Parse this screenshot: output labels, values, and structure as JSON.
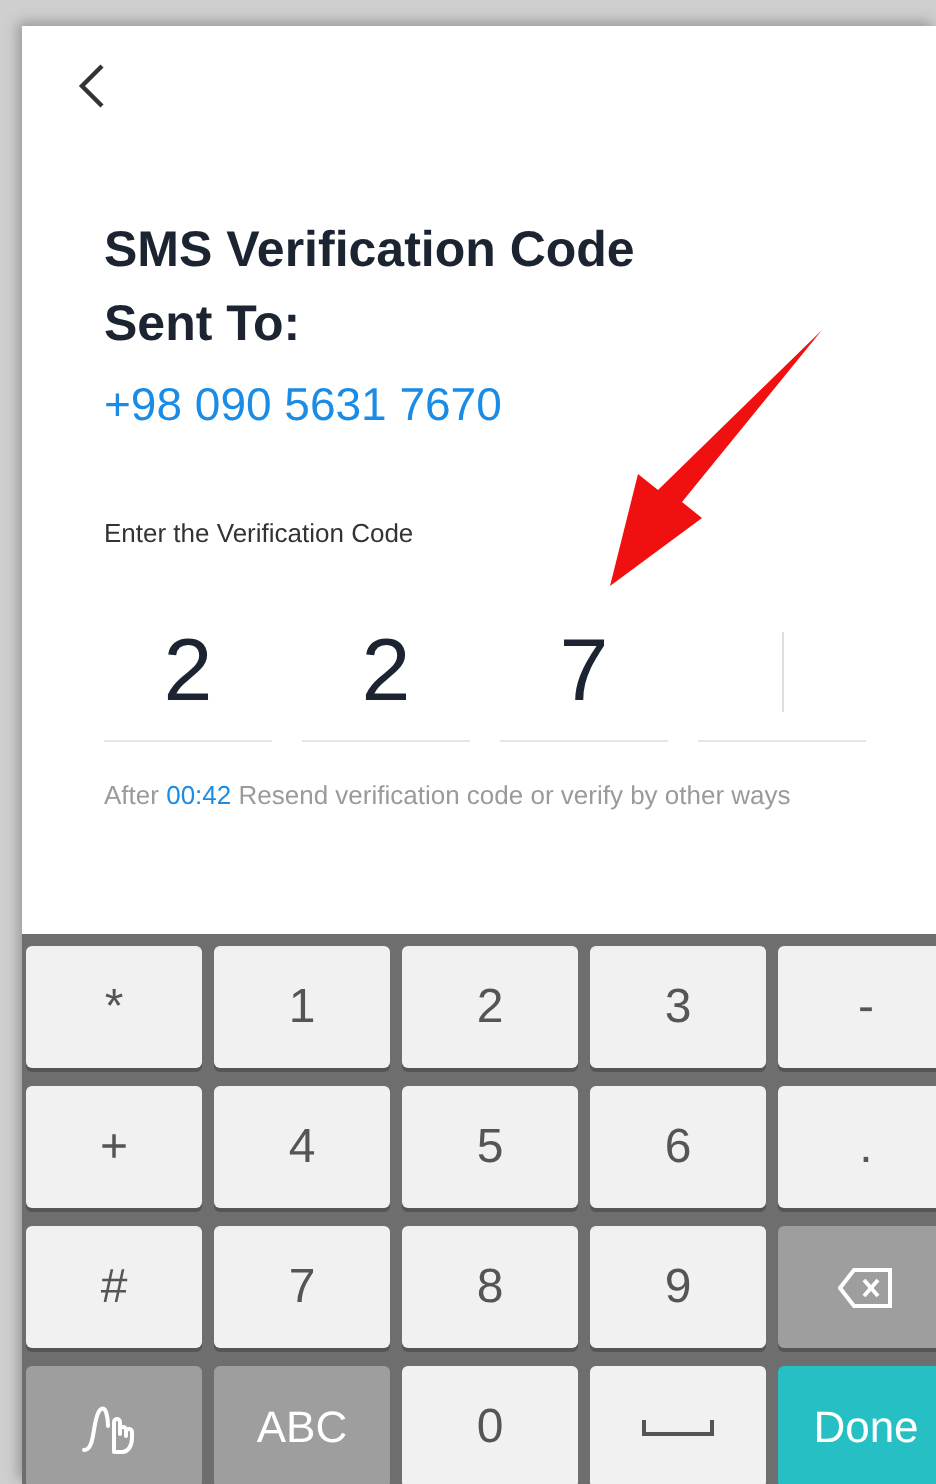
{
  "title": "SMS Verification Code Sent To:",
  "phone": "+98 090 5631 7670",
  "code_label": "Enter the Verification Code",
  "code_cells": [
    {
      "digit": "2",
      "focused": false
    },
    {
      "digit": "2",
      "focused": false
    },
    {
      "digit": "7",
      "focused": false
    },
    {
      "focused": true
    }
  ],
  "resend": {
    "before": "After",
    "timer": "00:42",
    "after": "Resend verification code or verify by other ways"
  },
  "keyboard": [
    {
      "kind": "char",
      "label": "*"
    },
    {
      "kind": "char",
      "label": "1"
    },
    {
      "kind": "char",
      "label": "2"
    },
    {
      "kind": "char",
      "label": "3"
    },
    {
      "kind": "char",
      "label": "-"
    },
    {
      "kind": "char",
      "label": "+"
    },
    {
      "kind": "char",
      "label": "4"
    },
    {
      "kind": "char",
      "label": "5"
    },
    {
      "kind": "char",
      "label": "6"
    },
    {
      "kind": "char",
      "label": "."
    },
    {
      "kind": "char",
      "label": "#"
    },
    {
      "kind": "char",
      "label": "7"
    },
    {
      "kind": "char",
      "label": "8"
    },
    {
      "kind": "char",
      "label": "9"
    },
    {
      "kind": "backspace"
    },
    {
      "kind": "handwriting"
    },
    {
      "kind": "mode",
      "label": "ABC"
    },
    {
      "kind": "char",
      "label": "0"
    },
    {
      "kind": "space"
    },
    {
      "kind": "done",
      "label": "Done"
    }
  ]
}
